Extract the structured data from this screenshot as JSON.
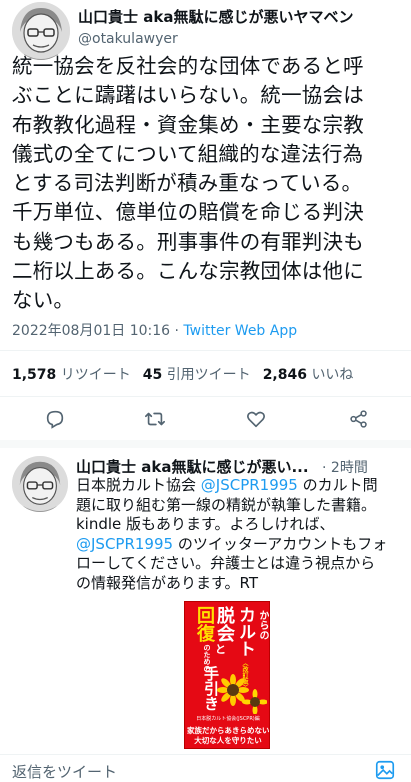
{
  "main_tweet": {
    "author_name": "山口貴士 aka無駄に感じが悪いヤマベン",
    "handle": "@otakulawyer",
    "body_lines": [
      "統一協会を反社会的な団体であると呼",
      "ぶことに躊躇はいらない。統一協会は",
      "布教教化過程・資金集め・主要な宗教",
      "儀式の全てについて組織的な違法行為",
      "とする司法判断が積み重なっている。",
      "千万単位、億単位の賠償を命じる判決",
      "も幾つもある。刑事事件の有罪判決も",
      "二桁以上ある。こんな宗教団体は他に",
      "ない。"
    ],
    "timestamp": "2022年08月01日 10:16",
    "separator": "·",
    "via": "Twitter Web App"
  },
  "stats": {
    "retweets_count": "1,578",
    "retweets_label": "リツイート",
    "quotes_count": "45",
    "quotes_label": "引用ツイート",
    "likes_count": "2,846",
    "likes_label": "いいね"
  },
  "actions": [
    "reply-icon",
    "retweet-icon",
    "like-icon",
    "share-icon"
  ],
  "reply_tweet": {
    "author_name": "山口貴士 aka無駄に感じが悪い...",
    "time_sep": "·",
    "time": "2時間",
    "lines": [
      {
        "parts": [
          {
            "text": "日本脱カルト協会 ",
            "link": false
          },
          {
            "text": "@JSCPR1995",
            "link": true
          },
          {
            "text": " のカルト問",
            "link": false
          }
        ]
      },
      {
        "parts": [
          {
            "text": "題に取り組む第一線の精鋭が執筆した書籍。",
            "link": false
          }
        ]
      },
      {
        "parts": [
          {
            "text": "kindle 版もあります。よろしければ、",
            "link": false
          }
        ]
      },
      {
        "parts": [
          {
            "text": "@JSCPR1995",
            "link": true
          },
          {
            "text": " のツイッターアカウントもフォ",
            "link": false
          }
        ]
      },
      {
        "parts": [
          {
            "text": "ローしてください。弁護士とは違う視点から",
            "link": false
          }
        ]
      },
      {
        "parts": [
          {
            "text": "の情報発信があります。RT",
            "link": false
          }
        ]
      }
    ],
    "book": {
      "line1": "カルト",
      "line1_small": "からの",
      "line2": "脱会",
      "line2_small": "と",
      "line3": "回復",
      "line3_small": "のための",
      "line4": "手引き",
      "edition": "〈改訂版〉",
      "org": "日本脱カルト協会(JSCPR)編",
      "tagline1": "家族だからあきらめない",
      "tagline2": "大切な人を守りたい"
    }
  },
  "reply_bar": {
    "placeholder": "返信をツイート"
  },
  "colors": {
    "link": "#1d9bf0",
    "muted": "#536471",
    "book_red": "#e50914",
    "book_yellow": "#ffe100"
  }
}
